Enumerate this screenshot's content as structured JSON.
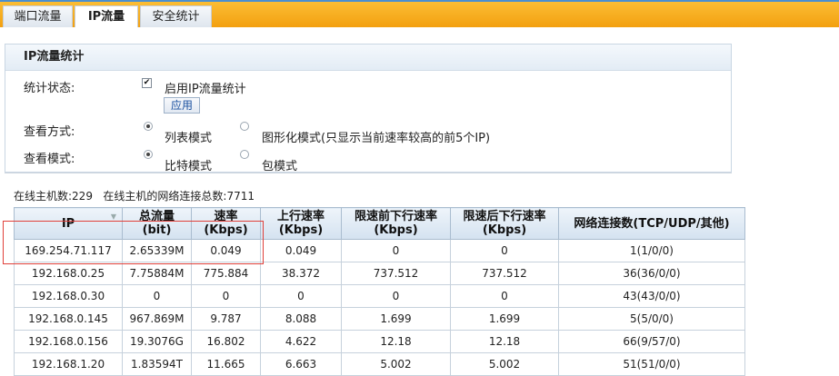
{
  "tabs": [
    {
      "label": "端口流量"
    },
    {
      "label": "IP流量"
    },
    {
      "label": "安全统计"
    }
  ],
  "panel": {
    "title": "IP流量统计",
    "stat_status_label": "统计状态:",
    "enable_label": "启用IP流量统计",
    "enable_checked": true,
    "apply_label": "应用",
    "view_method_label": "查看方式:",
    "list_mode_label": "列表模式",
    "graph_mode_label": "图形化模式(只显示当前速率较高的前5个IP)",
    "view_mode_label": "查看模式:",
    "bit_mode_label": "比特模式",
    "packet_mode_label": "包模式"
  },
  "summary": {
    "online_hosts_label": "在线主机数:",
    "online_hosts": "229",
    "connections_label": "在线主机的网络连接总数:",
    "connections": "7711"
  },
  "table": {
    "headers": [
      {
        "line1": "IP",
        "line2": ""
      },
      {
        "line1": "总流量",
        "line2": "(bit)"
      },
      {
        "line1": "速率",
        "line2": "(Kbps)"
      },
      {
        "line1": "上行速率",
        "line2": "(Kbps)"
      },
      {
        "line1": "限速前下行速率",
        "line2": "(Kbps)"
      },
      {
        "line1": "限速后下行速率",
        "line2": "(Kbps)"
      },
      {
        "line1": "网络连接数(TCP/UDP/其他)",
        "line2": ""
      }
    ],
    "rows": [
      [
        "169.254.71.117",
        "2.65339M",
        "0.049",
        "0.049",
        "0",
        "0",
        "1(1/0/0)"
      ],
      [
        "192.168.0.25",
        "7.75884M",
        "775.884",
        "38.372",
        "737.512",
        "737.512",
        "36(36/0/0)"
      ],
      [
        "192.168.0.30",
        "0",
        "0",
        "0",
        "0",
        "0",
        "43(43/0/0)"
      ],
      [
        "192.168.0.145",
        "967.869M",
        "9.787",
        "8.088",
        "1.699",
        "1.699",
        "5(5/0/0)"
      ],
      [
        "192.168.0.156",
        "19.3076G",
        "16.802",
        "4.622",
        "12.18",
        "12.18",
        "66(9/57/0)"
      ],
      [
        "192.168.1.20",
        "1.83594T",
        "11.665",
        "6.663",
        "5.002",
        "5.002",
        "51(51/0/0)"
      ]
    ]
  },
  "colors": {
    "tabbar_accent": "#f3a010",
    "highlight_box": "#e0403a"
  }
}
